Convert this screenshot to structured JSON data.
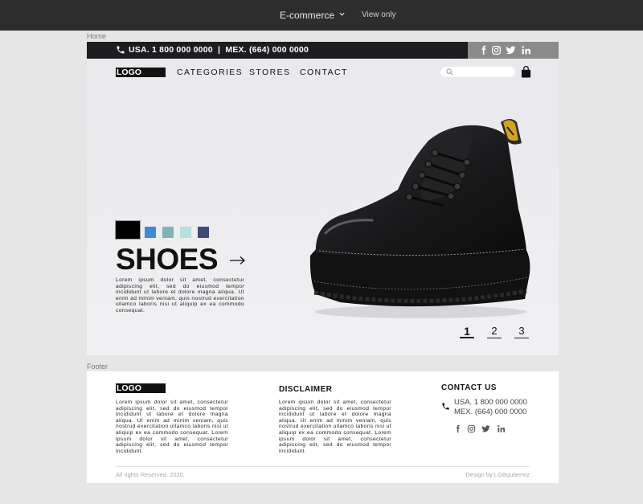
{
  "app": {
    "title": "E-commerce",
    "mode": "View only"
  },
  "frames": {
    "home": "Home",
    "footer": "Footer"
  },
  "header": {
    "contact": "USA. 1 800 000 0000  |  MEX. (664) 000 0000",
    "social_icons": [
      "facebook-icon",
      "instagram-icon",
      "twitter-icon",
      "linkedin-icon"
    ],
    "logo": "LOGO",
    "nav": [
      "CATEGORIES",
      "STORES",
      "CONTACT"
    ],
    "search_placeholder": ""
  },
  "hero": {
    "swatches": [
      "#000000",
      "#3d8ad6",
      "#7fb5b1",
      "#b4e0dd",
      "#3f4a7a"
    ],
    "title": "SHOES",
    "description": "Lorem ipsum dolor sit amet, consectetur adipiscing elit, sed do eiusmod tempor incididunt ut labore et dolore magna aliqua. Ut enim ad minim veniam, quis nostrud exercitation ullamco laboris nisi ut aliquip ex ea commodo consequat.",
    "pages": [
      "1",
      "2",
      "3"
    ],
    "active_page": "1"
  },
  "footer": {
    "logo": "LOGO",
    "about_text": "Lorem ipsum dolor sit amet, consectetur adipiscing elit, sed do eiusmod tempor incididunt ut labore et dolore magna aliqua. Ut enim ad minim veniam, quis nostrud exercitation ullamco laboris nisi ut aliquip ex ea commodo consequat. Lorem ipsum dolor sit amet, consectetur adipiscing elit, sed do eiusmod tempor incididunt.",
    "disclaimer_title": "DISCLAIMER",
    "disclaimer_text": "Lorem ipsum dolor sit amet, consectetur adipiscing elit, sed do eiusmod tempor incididunt ut labore et dolore magna aliqua. Ut enim ad minim veniam, quis nostrud exercitation ullamco laboris nisi ut aliquip ex ea commodo consequat. Lorem ipsum dolor sit amet, consectetur adipiscing elit, sed do eiusmod tempor incididunt.",
    "contact_title": "CONTACT US",
    "phone_usa": "USA. 1 800 000 0000",
    "phone_mex": "MEX. (664) 000 0000",
    "copyright": "All rights Reserved. 2020.",
    "credit": "Design by LGBgutierrez"
  },
  "colors": {
    "topbar": "#1d1d1f",
    "social_box": "#8b8b8b",
    "app_bar": "#2d2d2d"
  }
}
